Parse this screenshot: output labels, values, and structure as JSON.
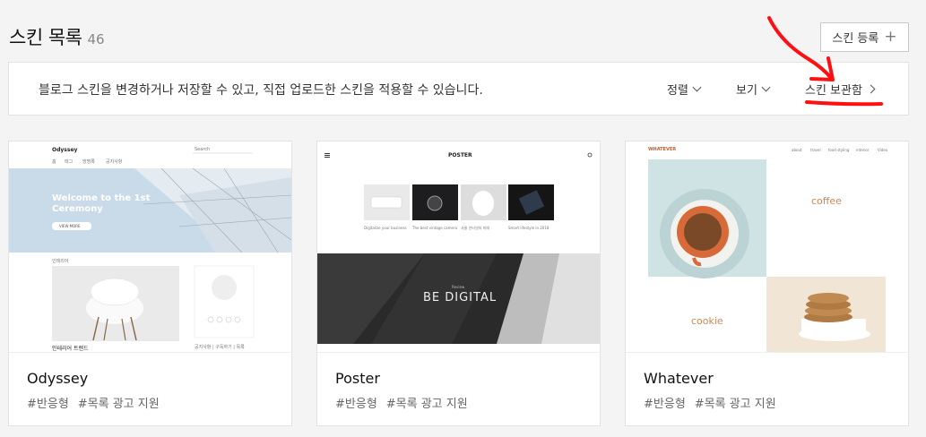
{
  "header": {
    "title": "스킨 목록",
    "count": "46"
  },
  "register_button": {
    "label": "스킨 등록",
    "icon": "plus-icon"
  },
  "info_bar": {
    "description": "블로그 스킨을 변경하거나 저장할 수 있고, 직접 업로드한 스킨을 적용할 수 있습니다.",
    "sort_label": "정렬",
    "view_label": "보기",
    "storage_label": "스킨 보관함"
  },
  "skins": [
    {
      "name": "Odyssey",
      "tags": [
        "#반응형",
        "#목록 광고 지원"
      ],
      "preview": {
        "logo": "Odyssey",
        "search": "Search",
        "nav": [
          "홈",
          "태그",
          "방명록",
          "공지사항"
        ],
        "hero_title": "Welcome to the 1st Ceremony",
        "hero_button": "VIEW MORE",
        "section_label": "인테리어",
        "post_title": "인테리어 트렌드",
        "footer_note": "공지사항 | 구독하기 | 목록"
      }
    },
    {
      "name": "Poster",
      "tags": [
        "#반응형",
        "#목록 광고 지원"
      ],
      "preview": {
        "logo": "POSTER",
        "banner_kicker": "Review",
        "banner_title": "BE DIGITAL",
        "captions": [
          "Digitalize your business",
          "The best vintage camera",
          "사물 인터넷의 미래",
          "Smart lifestyle in 2018"
        ]
      }
    },
    {
      "name": "Whatever",
      "tags": [
        "#반응형",
        "#목록 광고 지원"
      ],
      "preview": {
        "logo": "WHATEVER",
        "nav": [
          "about",
          "travel",
          "food styling",
          "interior",
          "Video"
        ],
        "word_coffee": "coffee",
        "word_cookie": "cookie"
      }
    }
  ],
  "colors": {
    "annotation": "#ff1010",
    "hero_sky": "#c9dbe8",
    "poster_dark": "#2a2a2a"
  }
}
